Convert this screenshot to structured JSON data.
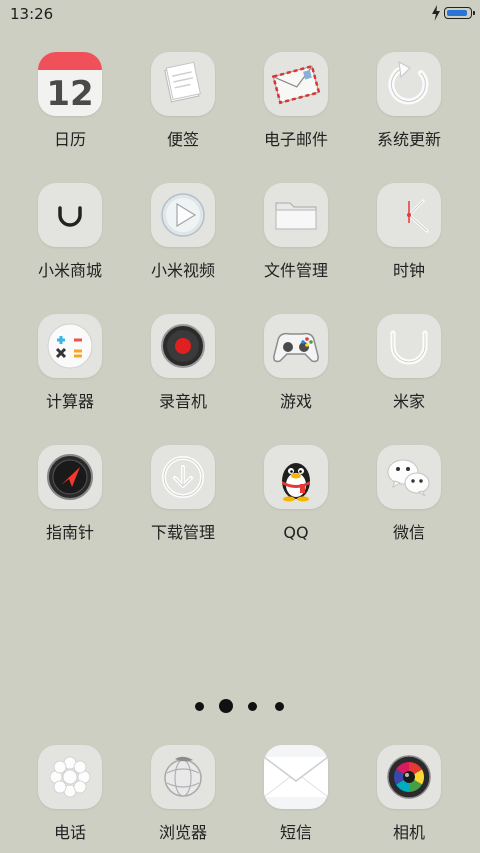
{
  "status_bar": {
    "time": "13:26",
    "battery_color": "#2a74d6"
  },
  "calendar_day": "12",
  "apps": [
    {
      "label": "日历",
      "icon": "calendar-icon"
    },
    {
      "label": "便签",
      "icon": "notes-icon"
    },
    {
      "label": "电子邮件",
      "icon": "email-icon"
    },
    {
      "label": "系统更新",
      "icon": "update-icon"
    },
    {
      "label": "小米商城",
      "icon": "mi-store-icon"
    },
    {
      "label": "小米视频",
      "icon": "video-play-icon"
    },
    {
      "label": "文件管理",
      "icon": "folder-icon"
    },
    {
      "label": "时钟",
      "icon": "clock-icon"
    },
    {
      "label": "计算器",
      "icon": "calculator-icon"
    },
    {
      "label": "录音机",
      "icon": "recorder-icon"
    },
    {
      "label": "游戏",
      "icon": "gamepad-icon"
    },
    {
      "label": "米家",
      "icon": "mijia-icon"
    },
    {
      "label": "指南针",
      "icon": "compass-icon"
    },
    {
      "label": "下载管理",
      "icon": "download-icon"
    },
    {
      "label": "QQ",
      "icon": "qq-penguin-icon"
    },
    {
      "label": "微信",
      "icon": "wechat-icon"
    }
  ],
  "pager": {
    "page_count": 4,
    "current_page": 2
  },
  "dock": [
    {
      "label": "电话",
      "icon": "phone-icon"
    },
    {
      "label": "浏览器",
      "icon": "browser-icon"
    },
    {
      "label": "短信",
      "icon": "messages-icon"
    },
    {
      "label": "相机",
      "icon": "camera-icon"
    }
  ]
}
